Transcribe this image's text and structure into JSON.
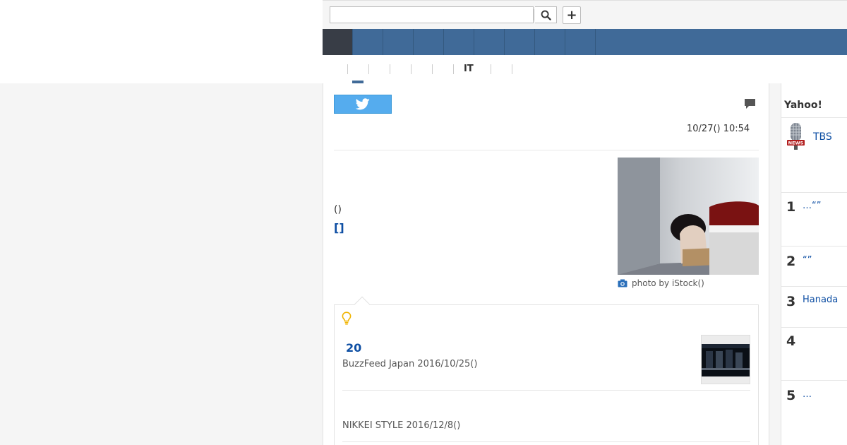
{
  "header": {
    "search_value": "",
    "search_placeholder": "",
    "plus_label": "+"
  },
  "category": {
    "label": "IT"
  },
  "article": {
    "datetime": "10/27() 10:54",
    "paragraph": "()",
    "bracket_link": "[]",
    "photo_caption": "photo by iStock()"
  },
  "related": {
    "item1_title": "20",
    "item1_source": "BuzzFeed Japan 2016/10/25()",
    "item2_source": "NIKKEI STYLE 2016/12/8()"
  },
  "sidebar": {
    "title": "Yahoo!",
    "provider": "TBS",
    "ranking": [
      {
        "rank": "1",
        "text": "…“”"
      },
      {
        "rank": "2",
        "text": "“”"
      },
      {
        "rank": "3",
        "text": "Hanada"
      },
      {
        "rank": "4",
        "text": ""
      },
      {
        "rank": "5",
        "text": "…"
      }
    ]
  },
  "colors": {
    "nav_blue": "#406a98",
    "nav_active": "#383d46",
    "twitter": "#55acee",
    "link_blue": "#0d4ea3",
    "bulb_yellow": "#f0b400"
  }
}
